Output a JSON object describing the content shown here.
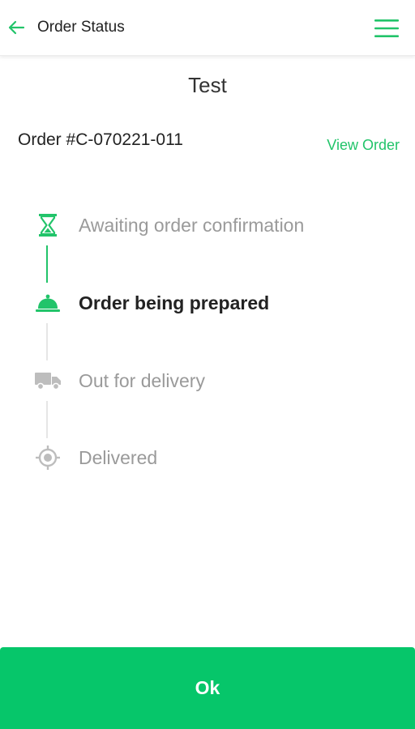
{
  "header": {
    "title": "Order Status",
    "back_icon": "arrow-left-icon",
    "menu_icon": "hamburger-menu-icon"
  },
  "store": {
    "name": "Test"
  },
  "order": {
    "number": "Order #C-070221-011",
    "view_label": "View Order"
  },
  "steps": [
    {
      "label": "Awaiting order confirmation",
      "icon": "hourglass-icon",
      "state": "done"
    },
    {
      "label": "Order being prepared",
      "icon": "serving-bell-icon",
      "state": "current"
    },
    {
      "label": "Out for delivery",
      "icon": "delivery-truck-icon",
      "state": "pending"
    },
    {
      "label": "Delivered",
      "icon": "location-target-icon",
      "state": "pending"
    }
  ],
  "footer": {
    "ok_label": "Ok"
  },
  "colors": {
    "accent": "#22c46a",
    "button": "#06c66a",
    "inactive": "#bdbdbd",
    "text": "#222222"
  }
}
